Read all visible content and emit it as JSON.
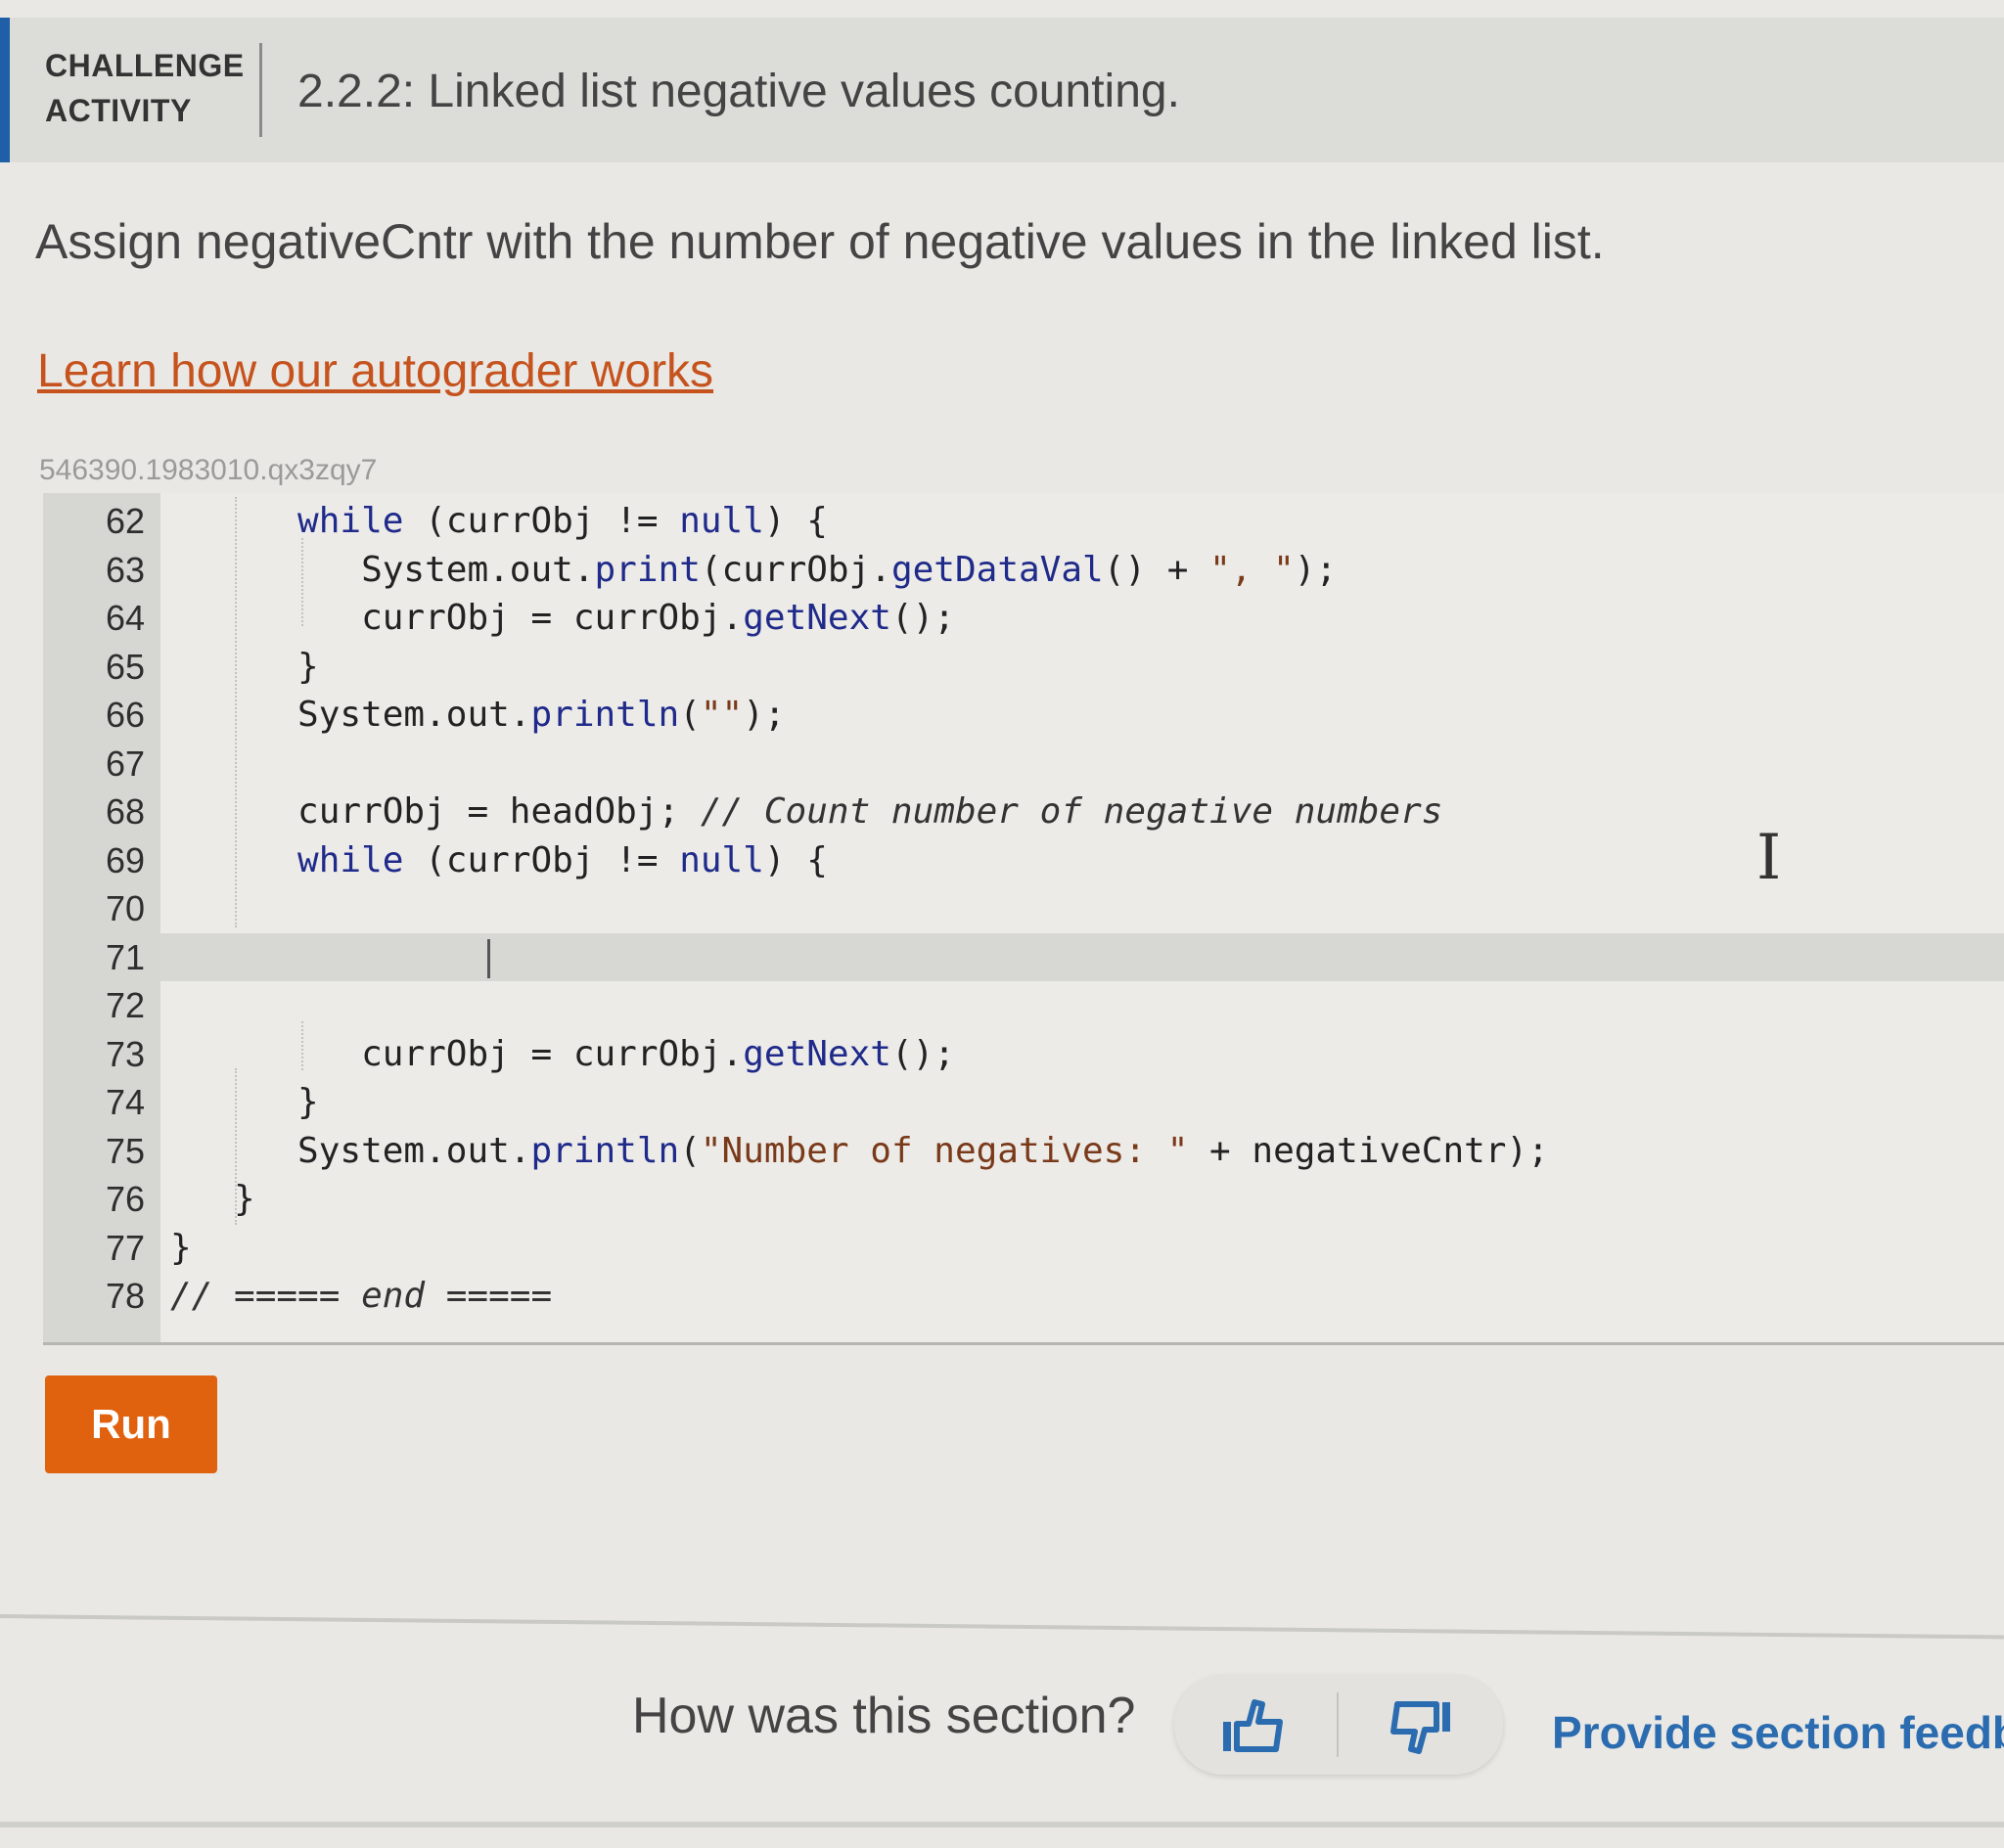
{
  "header": {
    "kind_line1": "CHALLENGE",
    "kind_line2": "ACTIVITY",
    "title": "2.2.2: Linked list negative values counting.",
    "accent_color": "#1f5fa8"
  },
  "instructions": "Assign negativeCntr with the number of negative values in the linked list.",
  "learn_link": "Learn how our autograder works",
  "activity_id": "546390.1983010.qx3zqy7",
  "editor": {
    "active_line": 71,
    "lines": [
      {
        "n": "62",
        "indent": "      ",
        "parts": [
          [
            "kw",
            "while"
          ],
          [
            "",
            "(currObj != "
          ],
          [
            "kw",
            "null"
          ],
          [
            "",
            ") {"
          ]
        ]
      },
      {
        "n": "63",
        "indent": "         ",
        "parts": [
          [
            "",
            "System.out."
          ],
          [
            "kw",
            "print"
          ],
          [
            "",
            "(currObj."
          ],
          [
            "kw",
            "getDataVal"
          ],
          [
            "",
            "() + "
          ],
          [
            "str",
            "\", \""
          ],
          [
            "",
            ");"
          ]
        ]
      },
      {
        "n": "64",
        "indent": "         ",
        "parts": [
          [
            "",
            "currObj = currObj."
          ],
          [
            "kw",
            "getNext"
          ],
          [
            "",
            "();"
          ]
        ]
      },
      {
        "n": "65",
        "indent": "      ",
        "parts": [
          [
            "",
            "}"
          ]
        ]
      },
      {
        "n": "66",
        "indent": "      ",
        "parts": [
          [
            "",
            "System.out."
          ],
          [
            "kw",
            "println"
          ],
          [
            "",
            "("
          ],
          [
            "str",
            "\"\""
          ],
          [
            "",
            ");"
          ]
        ]
      },
      {
        "n": "67",
        "indent": "",
        "parts": []
      },
      {
        "n": "68",
        "indent": "      ",
        "parts": [
          [
            "",
            "currObj = headObj; "
          ],
          [
            "cm",
            "// Count number of negative numbers"
          ]
        ]
      },
      {
        "n": "69",
        "indent": "      ",
        "parts": [
          [
            "kw",
            "while"
          ],
          [
            "",
            "(currObj != "
          ],
          [
            "kw",
            "null"
          ],
          [
            "",
            ") {"
          ]
        ]
      },
      {
        "n": "70",
        "indent": "",
        "parts": []
      },
      {
        "n": "71",
        "indent": "",
        "parts": []
      },
      {
        "n": "72",
        "indent": "",
        "parts": []
      },
      {
        "n": "73",
        "indent": "         ",
        "parts": [
          [
            "",
            "currObj = currObj."
          ],
          [
            "kw",
            "getNext"
          ],
          [
            "",
            "();"
          ]
        ]
      },
      {
        "n": "74",
        "indent": "      ",
        "parts": [
          [
            "",
            "}"
          ]
        ]
      },
      {
        "n": "75",
        "indent": "      ",
        "parts": [
          [
            "",
            "System.out."
          ],
          [
            "kw",
            "println"
          ],
          [
            "",
            "("
          ],
          [
            "str",
            "\"Number of negatives: \""
          ],
          [
            "",
            " + negativeCntr);"
          ]
        ]
      },
      {
        "n": "76",
        "indent": "   ",
        "parts": [
          [
            "",
            "}"
          ]
        ]
      },
      {
        "n": "77",
        "indent": "",
        "parts": [
          [
            "",
            "}"
          ]
        ]
      },
      {
        "n": "78",
        "indent": "",
        "parts": [
          [
            "cm",
            "// ===== end ====="
          ]
        ]
      }
    ]
  },
  "run_button": {
    "label": "Run",
    "color": "#e0620f"
  },
  "feedback": {
    "question": "How was this section?",
    "thumbs_up_icon": "thumbs-up-icon",
    "thumbs_down_icon": "thumbs-down-icon",
    "provide_link": "Provide section feedb"
  }
}
